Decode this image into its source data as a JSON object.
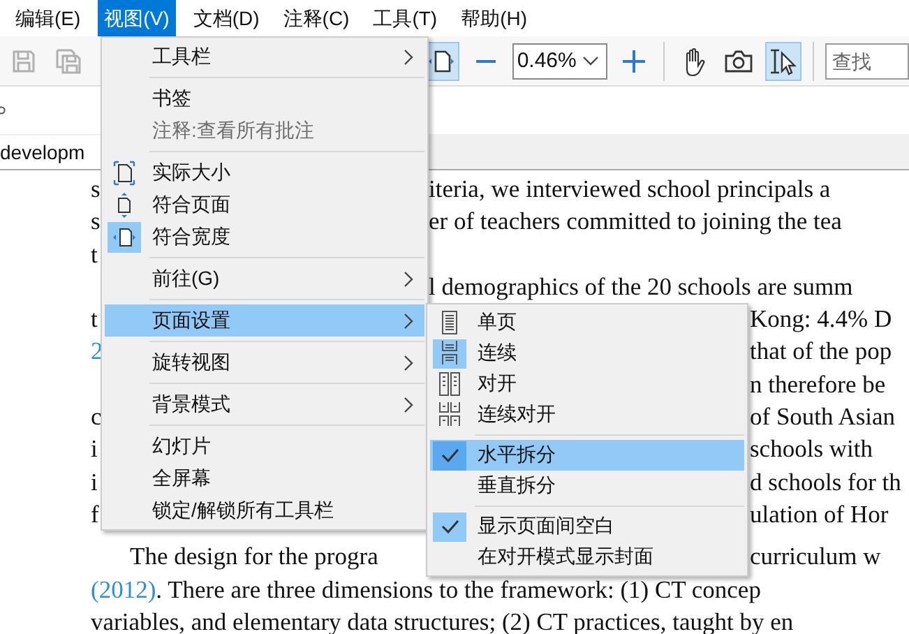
{
  "menubar": [
    {
      "label": "编辑(E)",
      "selected": false
    },
    {
      "label": "视图(V)",
      "selected": true
    },
    {
      "label": "文档(D)",
      "selected": false
    },
    {
      "label": "注释(C)",
      "selected": false
    },
    {
      "label": "工具(T)",
      "selected": false
    },
    {
      "label": "帮助(H)",
      "selected": false
    }
  ],
  "toolbar": {
    "left_buttons": [
      {
        "kind": "save",
        "disabled": true
      },
      {
        "kind": "save-copy",
        "disabled": true
      }
    ],
    "right_buttons": [
      {
        "kind": "fit-width",
        "selected": true
      },
      {
        "kind": "zoom-out",
        "selected": false
      }
    ],
    "zoom_value": "0.46%",
    "tool_buttons": [
      {
        "kind": "zoom-in",
        "selected": false
      },
      {
        "kind": "hand",
        "selected": false
      },
      {
        "kind": "camera",
        "selected": false
      },
      {
        "kind": "select",
        "selected": true
      }
    ],
    "search": {
      "placeholder": "查找"
    }
  },
  "tab": {
    "label": "developm"
  },
  "document": {
    "lines": [
      {
        "kind": "split-main",
        "paragraph_start": false,
        "left": [
          {
            "text": "s",
            "link": false
          }
        ],
        "right": [
          {
            "text": "iteria, we interviewed school principals a",
            "link": false
          }
        ]
      },
      {
        "kind": "split-main",
        "paragraph_start": false,
        "left": [
          {
            "text": "s",
            "link": false
          }
        ],
        "right": [
          {
            "text": "er of teachers committed to joining the tea",
            "link": false
          }
        ]
      },
      {
        "kind": "split-main",
        "paragraph_start": false,
        "left": [
          {
            "text": "t",
            "link": false
          }
        ]
      },
      {
        "kind": "split-main",
        "paragraph_start": false,
        "right": [
          {
            "text": "l demographics of the 20 schools are summ",
            "link": false
          }
        ]
      },
      {
        "kind": "split-sub",
        "paragraph_start": false,
        "left": [
          {
            "text": "t",
            "link": false
          }
        ],
        "right": [
          {
            "text": "Kong: 4.4% D",
            "link": false
          }
        ]
      },
      {
        "kind": "split-sub",
        "paragraph_start": false,
        "left": [
          {
            "text": "2",
            "link": true
          }
        ],
        "right": [
          {
            "text": "that of the pop",
            "link": false
          }
        ]
      },
      {
        "kind": "split-sub",
        "paragraph_start": false,
        "right": [
          {
            "text": "n therefore be",
            "link": false
          }
        ]
      },
      {
        "kind": "split-sub",
        "paragraph_start": false,
        "left": [
          {
            "text": "c",
            "link": false
          }
        ],
        "right": [
          {
            "text": "of South Asian",
            "link": false
          }
        ]
      },
      {
        "kind": "split-sub",
        "paragraph_start": false,
        "left": [
          {
            "text": "i",
            "link": false
          }
        ],
        "right": [
          {
            "text": "schools with",
            "link": false
          }
        ]
      },
      {
        "kind": "split-sub",
        "paragraph_start": false,
        "left": [
          {
            "text": "i",
            "link": false
          }
        ],
        "right": [
          {
            "text": "d schools for th",
            "link": false
          }
        ]
      },
      {
        "kind": "split-sub",
        "paragraph_start": false,
        "left": [
          {
            "text": "f",
            "link": false
          }
        ],
        "right": [
          {
            "text": "ulation of Hor",
            "link": false
          }
        ]
      },
      {
        "kind": "split-sub",
        "paragraph_start": true,
        "left": [
          {
            "text": "The design for the progra",
            "link": false
          }
        ],
        "right": [
          {
            "text": "curriculum w",
            "link": false
          }
        ]
      },
      {
        "kind": "full",
        "paragraph_start": false,
        "left": [
          {
            "text": "(2012)",
            "link": true
          },
          {
            "text": ". There are three dimensions to the framework: (1) CT concep",
            "link": false
          }
        ]
      },
      {
        "kind": "full",
        "paragraph_start": false,
        "left": [
          {
            "text": "variables, and elementary data structures; (2) CT practices, taught by en",
            "link": false
          }
        ]
      }
    ]
  },
  "view_menu": {
    "items": [
      {
        "kind": "text",
        "label": "工具栏",
        "submenu": true,
        "selected": false,
        "checked": false,
        "disabled": false
      },
      {
        "kind": "separator"
      },
      {
        "kind": "text",
        "label": "书签",
        "submenu": false,
        "selected": false,
        "checked": false,
        "disabled": false
      },
      {
        "kind": "text",
        "label": "注释:查看所有批注",
        "submenu": false,
        "selected": false,
        "checked": false,
        "disabled": true
      },
      {
        "kind": "separator"
      },
      {
        "kind": "actual-size",
        "label": "实际大小",
        "submenu": false,
        "selected": false,
        "checked": false,
        "disabled": false
      },
      {
        "kind": "fit-page",
        "label": "符合页面",
        "submenu": false,
        "selected": false,
        "checked": false,
        "disabled": false
      },
      {
        "kind": "fit-width",
        "label": "符合宽度",
        "submenu": false,
        "selected": false,
        "checked": true,
        "disabled": false
      },
      {
        "kind": "separator"
      },
      {
        "kind": "text",
        "label": "前往(G)",
        "submenu": true,
        "selected": false,
        "checked": false,
        "disabled": false
      },
      {
        "kind": "separator"
      },
      {
        "kind": "text",
        "label": "页面设置",
        "submenu": true,
        "selected": true,
        "checked": false,
        "disabled": false
      },
      {
        "kind": "separator"
      },
      {
        "kind": "text",
        "label": "旋转视图",
        "submenu": true,
        "selected": false,
        "checked": false,
        "disabled": false
      },
      {
        "kind": "separator"
      },
      {
        "kind": "text",
        "label": "背景模式",
        "submenu": true,
        "selected": false,
        "checked": false,
        "disabled": false
      },
      {
        "kind": "separator"
      },
      {
        "kind": "text",
        "label": "幻灯片",
        "submenu": false,
        "selected": false,
        "checked": false,
        "disabled": false
      },
      {
        "kind": "text",
        "label": "全屏幕",
        "submenu": false,
        "selected": false,
        "checked": false,
        "disabled": false
      },
      {
        "kind": "text",
        "label": "锁定/解锁所有工具栏",
        "submenu": false,
        "selected": false,
        "checked": false,
        "disabled": false
      }
    ]
  },
  "page_setup_submenu": {
    "items": [
      {
        "kind": "single",
        "label": "单页",
        "selected": false,
        "checked": false
      },
      {
        "kind": "continuous",
        "label": "连续",
        "selected": false,
        "checked": true
      },
      {
        "kind": "facing",
        "label": "对开",
        "selected": false,
        "checked": false
      },
      {
        "kind": "continuous-facing",
        "label": "连续对开",
        "selected": false,
        "checked": false
      },
      {
        "kind": "separator"
      },
      {
        "kind": "text",
        "label": "水平拆分",
        "selected": true,
        "checked": true
      },
      {
        "kind": "text",
        "label": "垂直拆分",
        "selected": false,
        "checked": false
      },
      {
        "kind": "separator"
      },
      {
        "kind": "text",
        "label": "显示页面间空白",
        "selected": false,
        "checked": true
      },
      {
        "kind": "text",
        "label": "在对开模式显示封面",
        "selected": false,
        "checked": false
      }
    ]
  }
}
